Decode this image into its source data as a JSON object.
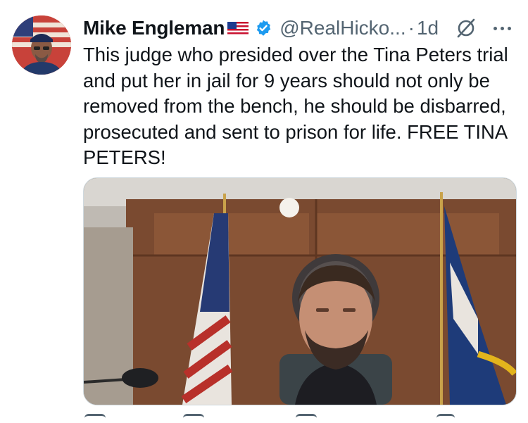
{
  "post": {
    "author_name": "Mike Engleman",
    "author_flag": "us-flag-emoji",
    "verified": "verified-badge-icon",
    "handle": "@RealHicko...",
    "separator": "·",
    "time": "1d",
    "text": "This judge who presided over the Tina Peters trial and put her in jail for 9 years should not only be removed from the bench, he should be disbarred, prosecuted and sent to prison for life. FREE TINA PETERS!"
  },
  "icons": {
    "grok": "grok-icon",
    "more": "more-icon"
  },
  "colors": {
    "text": "#0f1419",
    "secondary": "#536471",
    "verified": "#1d9bf0"
  }
}
